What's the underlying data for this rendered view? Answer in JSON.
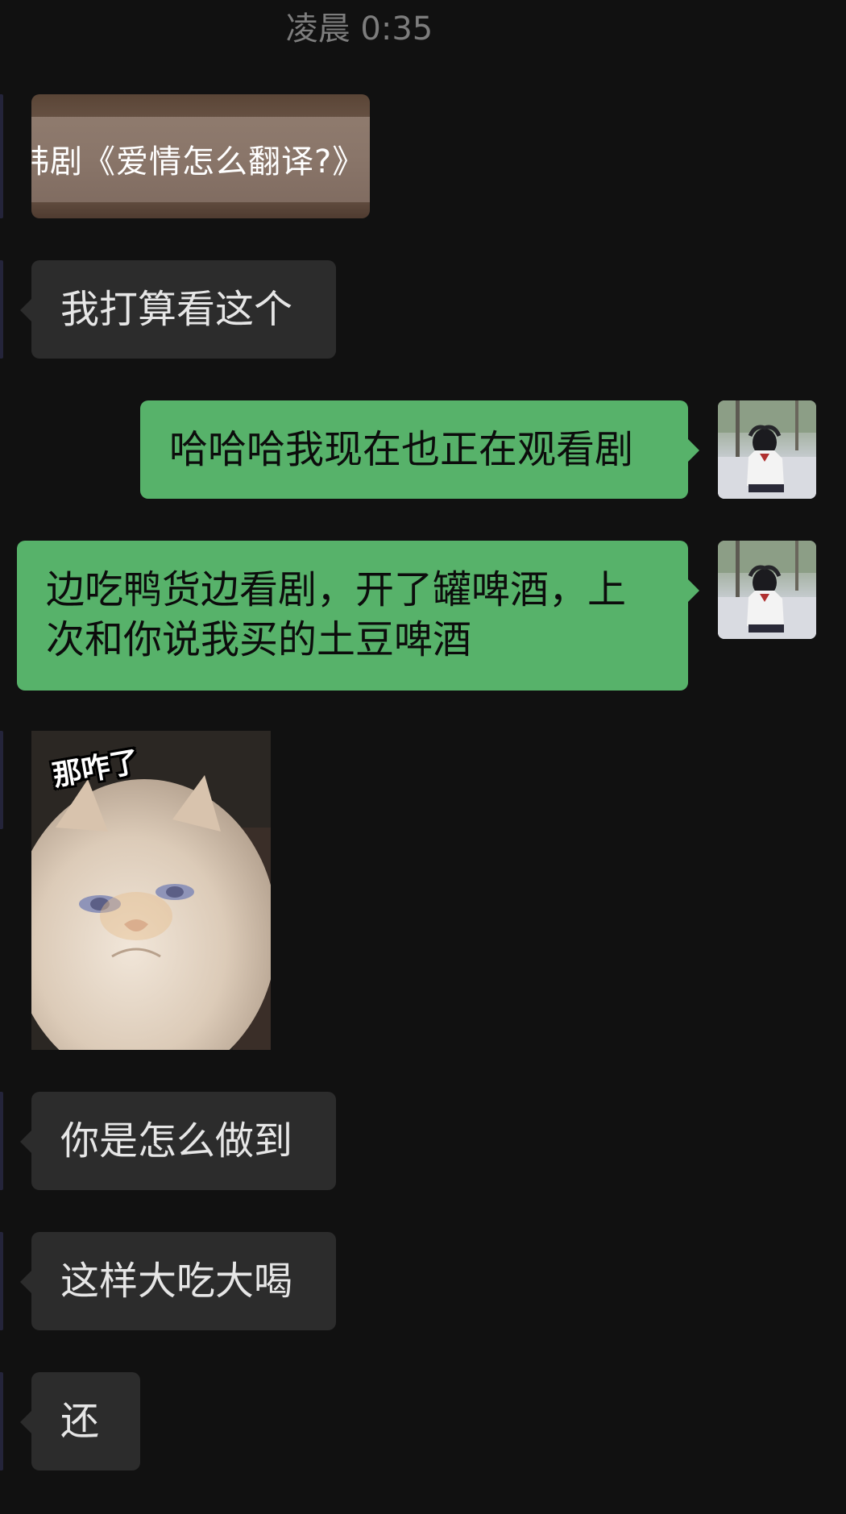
{
  "timestamp": "凌晨 0:35",
  "link_preview": {
    "title": "韩剧《爱情怎么翻译?》"
  },
  "messages": [
    {
      "from": "them",
      "type": "text",
      "text": "我打算看这个"
    },
    {
      "from": "me",
      "type": "text",
      "text": "哈哈哈我现在也正在观看剧"
    },
    {
      "from": "me",
      "type": "text",
      "text": "边吃鸭货边看剧，开了罐啤酒，上次和你说我买的土豆啤酒"
    },
    {
      "from": "them",
      "type": "sticker",
      "caption": "那咋了"
    },
    {
      "from": "them",
      "type": "text",
      "text": "你是怎么做到"
    },
    {
      "from": "them",
      "type": "text",
      "text": "这样大吃大喝"
    },
    {
      "from": "them",
      "type": "text",
      "text": "还"
    }
  ],
  "colors": {
    "background": "#111111",
    "incoming_bubble": "#2c2c2c",
    "outgoing_bubble": "#57b26a",
    "timestamp_text": "#7d7d7d"
  },
  "icons": {
    "my_avatar": "avatar-girl-photo-icon",
    "sticker": "white-persian-cat-sticker"
  }
}
